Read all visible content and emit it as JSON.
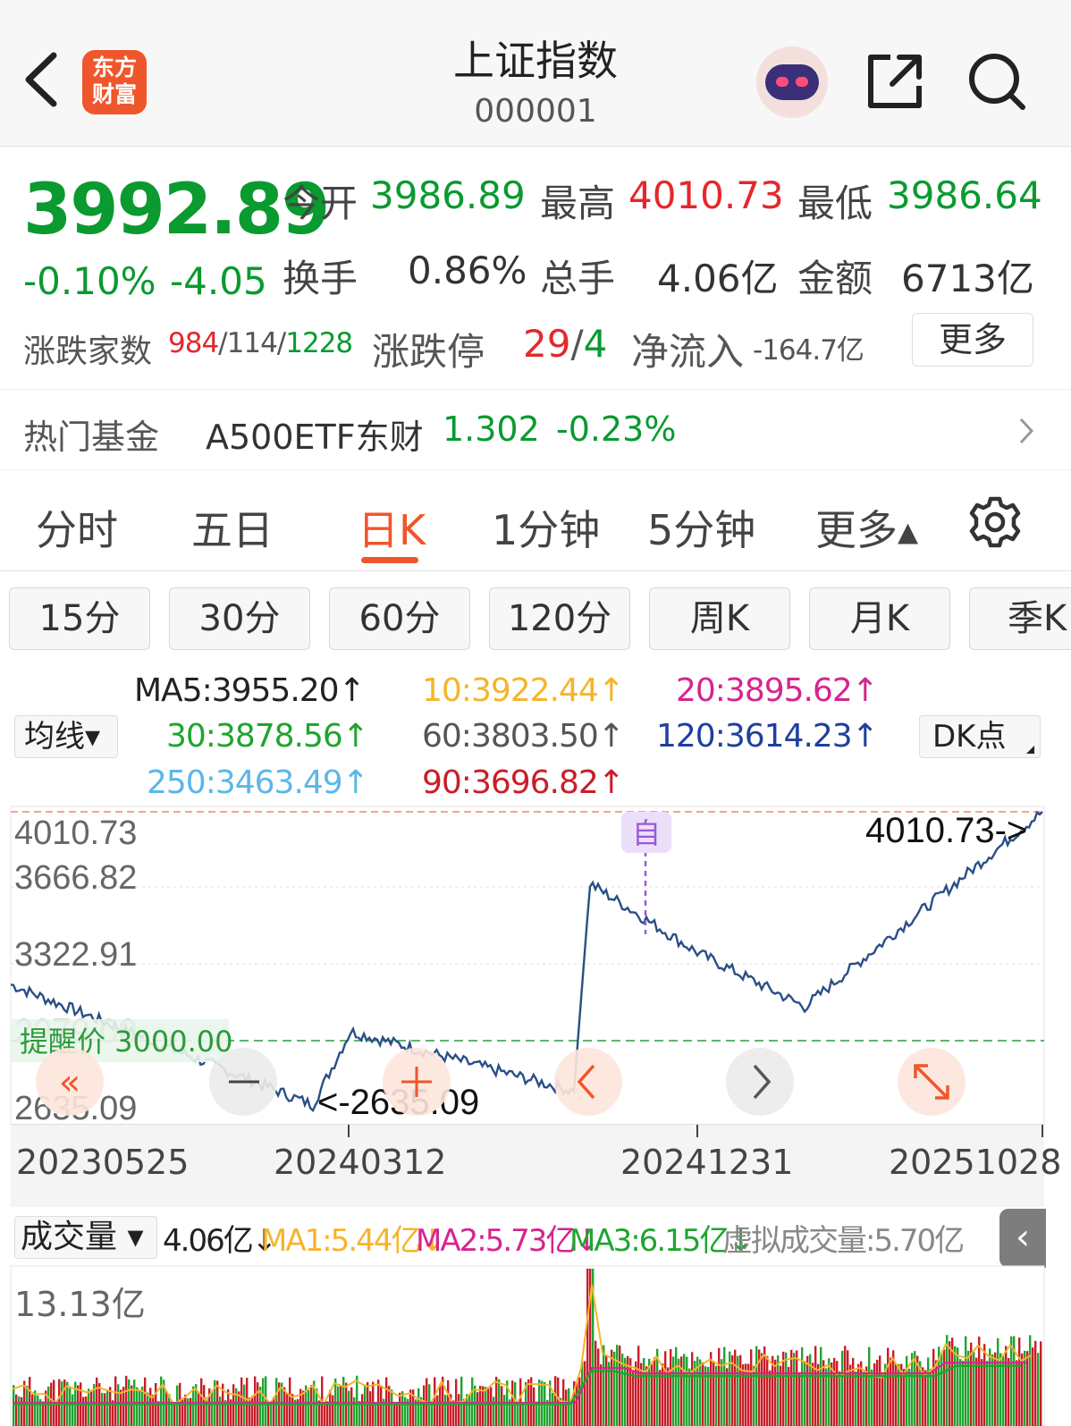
{
  "header": {
    "title": "上证指数",
    "code": "000001",
    "logo_line1": "东方",
    "logo_line2": "财富",
    "back_icon": "chevron-left-icon",
    "share_icon": "share-icon",
    "search_icon": "search-icon"
  },
  "quote": {
    "price": "3992.89",
    "change_pct": "-0.10%",
    "change": "-4.05",
    "open_label": "今开",
    "open": "3986.89",
    "high_label": "最高",
    "high": "4010.73",
    "low_label": "最低",
    "low": "3986.64",
    "turnover_label": "换手",
    "turnover": "0.86%",
    "volume_label": "总手",
    "volume": "4.06亿",
    "amount_label": "金额",
    "amount": "6713亿",
    "breadth_label": "涨跌家数",
    "breadth_up": "984",
    "breadth_sep1": "/",
    "breadth_flat": "114",
    "breadth_sep2": "/",
    "breadth_down": "1228",
    "limit_label": "涨跌停",
    "limit_up": "29",
    "limit_sep": "/",
    "limit_down": "4",
    "netflow_label": "净流入",
    "netflow": "-164.7亿",
    "more_label": "更多"
  },
  "fund": {
    "label": "热门基金",
    "name": "A500ETF东财",
    "price": "1.302",
    "change": "-0.23%"
  },
  "tabs": [
    {
      "label": "分时"
    },
    {
      "label": "五日"
    },
    {
      "label": "日K"
    },
    {
      "label": "1分钟"
    },
    {
      "label": "5分钟"
    },
    {
      "label": "更多▴"
    }
  ],
  "periods": [
    "15分",
    "30分",
    "60分",
    "120分",
    "周K",
    "月K",
    "季K"
  ],
  "ma": {
    "ma5": "MA5:3955.20↑",
    "ma10": "10:3922.44↑",
    "ma20": "20:3895.62↑",
    "ma30": "30:3878.56↑",
    "ma60": "60:3803.50↑",
    "ma120": "120:3614.23↑",
    "ma250": "250:3463.49↑",
    "ma90": "90:3696.82↑",
    "junxian": "均线▾",
    "dk": "DK点",
    "colors": {
      "ma5": "#222222",
      "ma10": "#f5b52a",
      "ma20": "#d6248f",
      "ma30": "#1fa52f",
      "ma60": "#555555",
      "ma120": "#1f3f9f",
      "ma250": "#5bb7e8",
      "ma90": "#c81e28"
    }
  },
  "chart": {
    "y_labels": [
      "4010.73",
      "3666.82",
      "3322.91",
      "2979.00",
      "2635.09"
    ],
    "high_marker": "4010.73->",
    "low_marker": "<-2635.09",
    "alert_label": "提醒价 3000.00",
    "marker_zi": "自",
    "dates": [
      "20230525",
      "20240312",
      "20241231",
      "20251028"
    ],
    "line_color": "#2a4f86",
    "alert_color": "#2d9a3c"
  },
  "volume": {
    "select_label": "成交量 ▾",
    "current": "4.06亿↓",
    "ma1": "MA1:5.44亿↓",
    "ma2": "MA2:5.73亿↓",
    "ma3": "MA3:6.15亿↓",
    "virtual": "虚拟成交量:5.70亿",
    "max_label": "13.13亿",
    "collapse_icon": "‹"
  },
  "chart_data": {
    "type": "line",
    "title": "上证指数 日K",
    "x": [
      "20230525",
      "20240205",
      "20240312",
      "20240924",
      "20241008",
      "20241231",
      "20250407",
      "20251028"
    ],
    "series": [
      {
        "values": [
          3200,
          2635.09,
          2980,
          2700,
          3674,
          3351,
          3096,
          4010.73
        ]
      }
    ],
    "ylim": [
      2635.09,
      4010.73
    ],
    "reference_line": 3000.0
  }
}
